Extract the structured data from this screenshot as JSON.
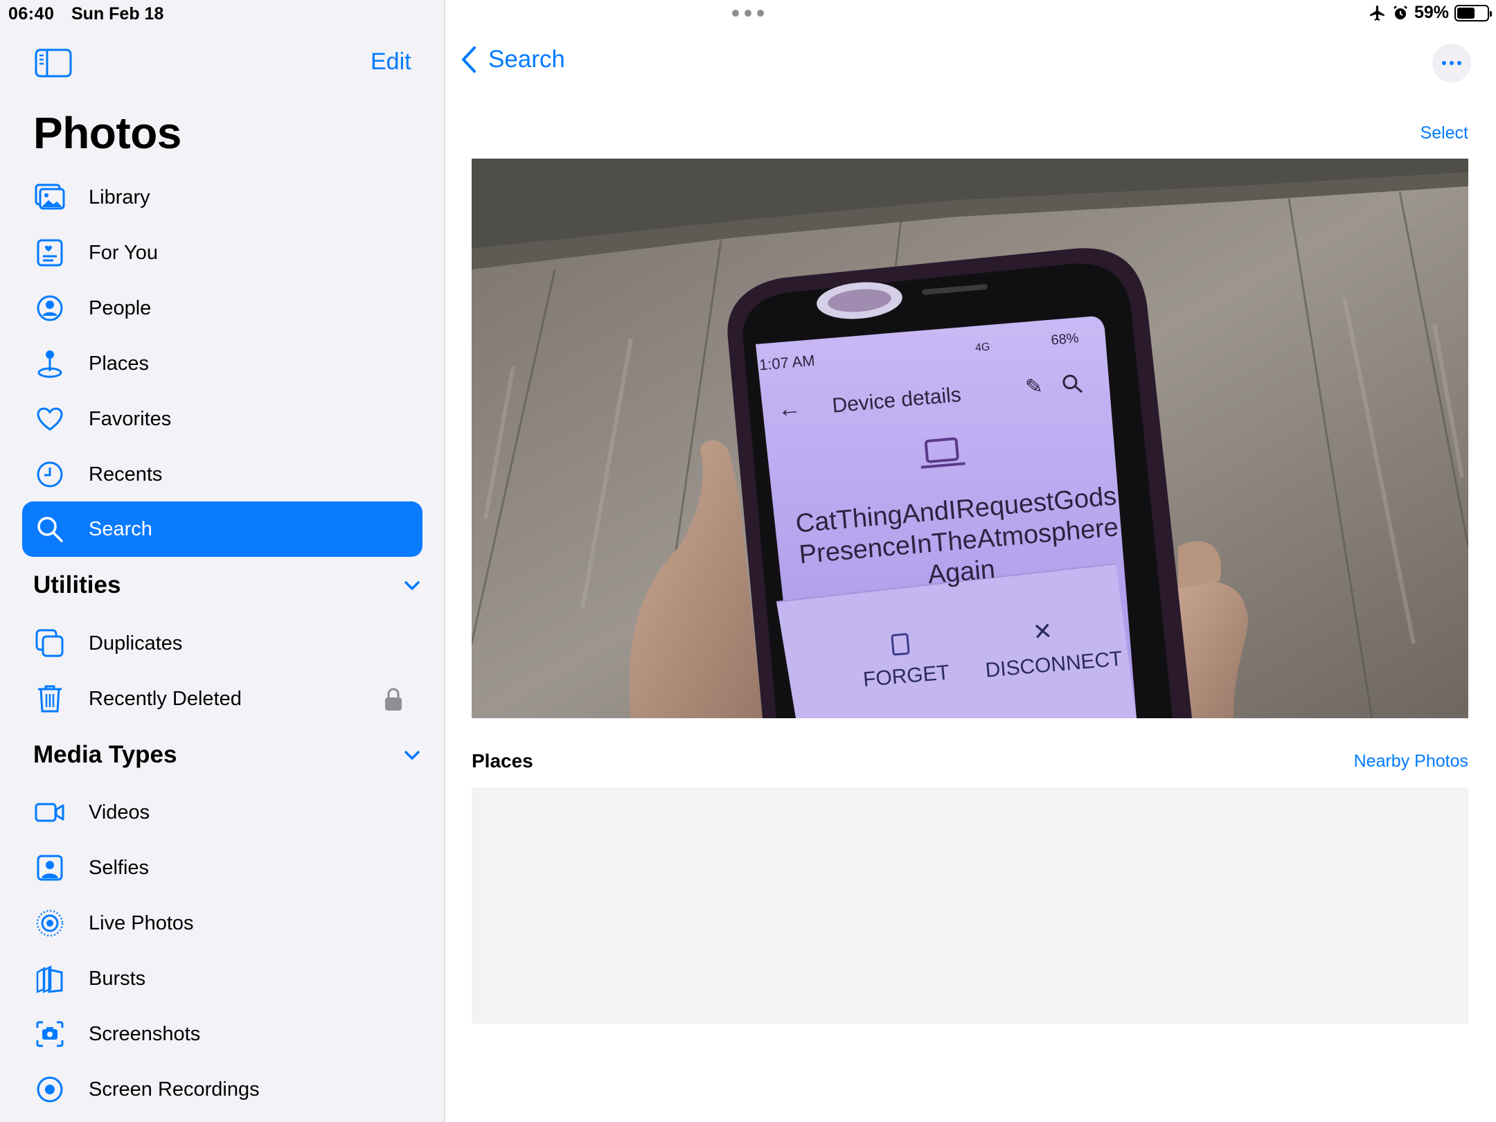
{
  "status_bar": {
    "time": "06:40",
    "date": "Sun Feb 18",
    "battery_percent": "59%",
    "battery_level": 0.59,
    "icons": [
      "airplane-icon",
      "alarm-icon",
      "battery-icon"
    ]
  },
  "sidebar": {
    "edit_label": "Edit",
    "title": "Photos",
    "items": [
      {
        "label": "Library",
        "icon": "library-icon"
      },
      {
        "label": "For You",
        "icon": "for-you-icon"
      },
      {
        "label": "People",
        "icon": "people-icon"
      },
      {
        "label": "Places",
        "icon": "places-icon"
      },
      {
        "label": "Favorites",
        "icon": "heart-icon"
      },
      {
        "label": "Recents",
        "icon": "clock-icon"
      },
      {
        "label": "Search",
        "icon": "search-icon",
        "active": true
      }
    ],
    "utilities": {
      "title": "Utilities",
      "items": [
        {
          "label": "Duplicates",
          "icon": "duplicates-icon"
        },
        {
          "label": "Recently Deleted",
          "icon": "trash-icon",
          "locked": true
        }
      ]
    },
    "media_types": {
      "title": "Media Types",
      "items": [
        {
          "label": "Videos",
          "icon": "video-icon"
        },
        {
          "label": "Selfies",
          "icon": "selfie-icon"
        },
        {
          "label": "Live Photos",
          "icon": "live-photo-icon"
        },
        {
          "label": "Bursts",
          "icon": "bursts-icon"
        },
        {
          "label": "Screenshots",
          "icon": "screenshot-icon"
        },
        {
          "label": "Screen Recordings",
          "icon": "screen-recording-icon"
        }
      ]
    }
  },
  "main": {
    "back_label": "Search",
    "select_label": "Select",
    "places_title": "Places",
    "nearby_label": "Nearby Photos",
    "photo": {
      "phone_time": "1:07 AM",
      "phone_battery": "68%",
      "phone_network": "4G",
      "screen_title": "Device details",
      "device_name_lines": [
        "CatThingAndIRequestGods",
        "PresenceInTheAtmosphere",
        "Again"
      ],
      "forget_label": "FORGET",
      "disconnect_label": "DISCONNECT"
    }
  },
  "colors": {
    "accent": "#007aff",
    "active_row": "#0a7aff",
    "sidebar_bg": "#f2f2f7",
    "phone_screen": "#b7a6ef"
  }
}
